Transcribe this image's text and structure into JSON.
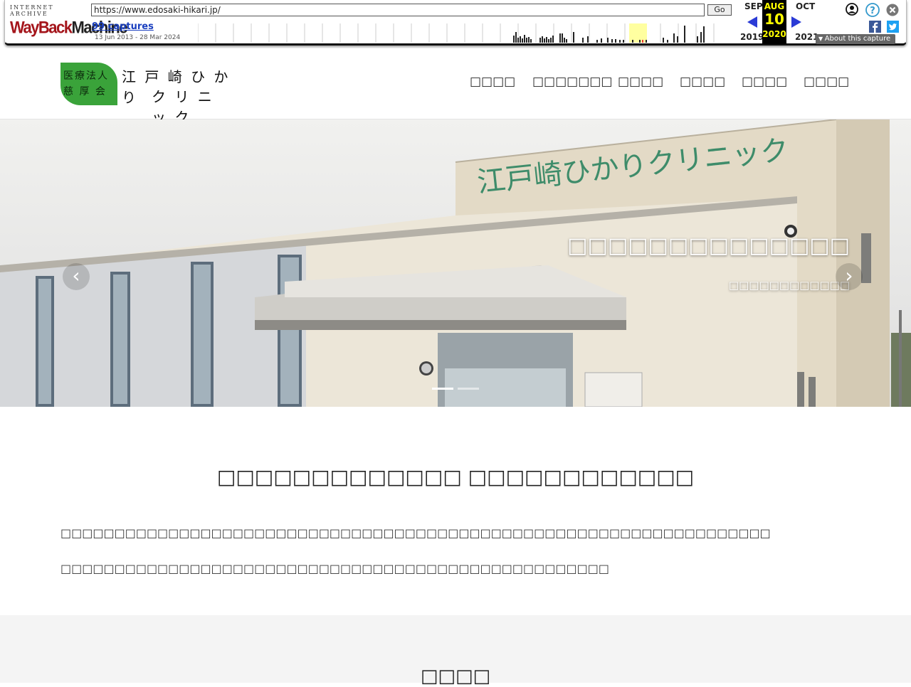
{
  "wayback": {
    "logo_top": "INTERNET ARCHIVE",
    "logo_way": "WayBack",
    "logo_machine": "Machine",
    "url": "https://www.edosaki-hikari.jp/",
    "go_label": "Go",
    "captures": "99 captures",
    "date_range": "13 Jun 2013 - 28 Mar 2024",
    "prev_month": "SEP",
    "cur_month": "AUG",
    "next_month": "OCT",
    "cur_day": "10",
    "prev_year": "2019",
    "cur_year": "2020",
    "next_year": "2021",
    "about": "About this capture"
  },
  "site": {
    "logo_org1": "医療法人",
    "logo_org2": "慈 厚 会",
    "logo_name1": "江 戸 崎 ひ か り",
    "logo_name2": "ク リ ニ ッ ク",
    "nav": [
      "□□□□",
      "□□□□□□□",
      "□□□□",
      "□□□□",
      "□□□□",
      "□□□□"
    ],
    "hero_sign": "江戸崎ひかりクリニック",
    "hero_caption": "□□□□□□□□□□□□□□",
    "hero_subcaption": "□□□□□□□□□□□□",
    "intro_title": "□□□□□□□□□□□□□ □□□□□□□□□□□□",
    "intro_p1": "□□□□□□□□□□□□□□□□□□□□□□□□□□□□□□□□□□□□□□□□□□□□□□□□□□□□□□□□□□□□□□□□□□",
    "intro_p2": "□□□□□□□□□□□□□□□□□□□□□□□□□□□□□□□□□□□□□□□□□□□□□□□□□□□",
    "section_title": "□□□□"
  }
}
